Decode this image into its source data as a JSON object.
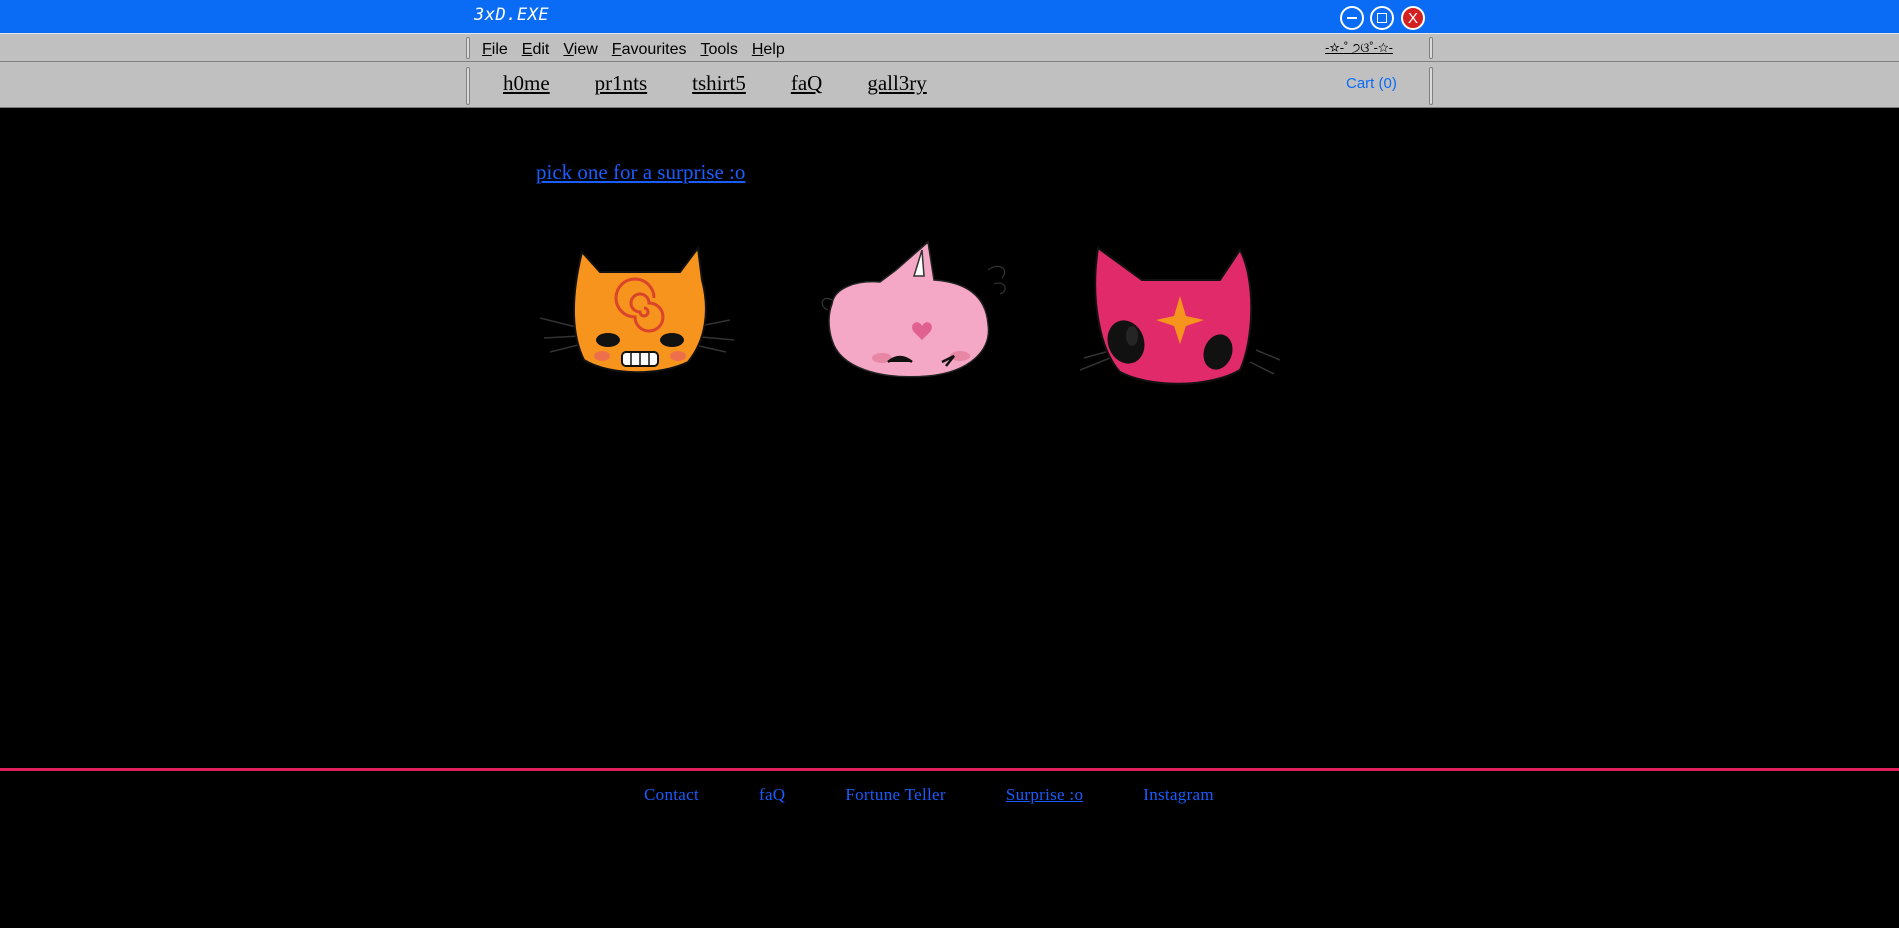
{
  "window": {
    "title": "3xD.EXE",
    "controls": {
      "minimize": "minimize",
      "maximize": "maximize",
      "close": "X"
    }
  },
  "menubar": {
    "items": [
      {
        "underline": "F",
        "rest": "ile"
      },
      {
        "underline": "E",
        "rest": "dit"
      },
      {
        "underline": "V",
        "rest": "iew"
      },
      {
        "underline": "F",
        "rest": "avourites"
      },
      {
        "underline": "T",
        "rest": "ools"
      },
      {
        "underline": "H",
        "rest": "elp"
      }
    ],
    "decoration": "-☆-˚ ੭ଓ˚-☆-"
  },
  "nav": {
    "links": [
      "h0me",
      "pr1nts",
      "tshirt5",
      "faQ",
      "gall3ry"
    ],
    "cart": "Cart (0)"
  },
  "main": {
    "prompt": "pick one for a surprise :o",
    "cats": [
      {
        "name": "orange-spiral-cat",
        "color": "#f7941d"
      },
      {
        "name": "pink-heart-cat",
        "color": "#f4a8c6"
      },
      {
        "name": "magenta-star-cat",
        "color": "#e02a6a"
      }
    ]
  },
  "footer": {
    "links": [
      "Contact",
      "faQ",
      "Fortune Teller",
      "Surprise :o",
      "Instagram"
    ],
    "active": "Surprise :o",
    "line_color": "#e0205a"
  },
  "colors": {
    "titlebar": "#0a6bf5",
    "chrome": "#c0c0c0",
    "link_blue": "#1a5cff"
  }
}
